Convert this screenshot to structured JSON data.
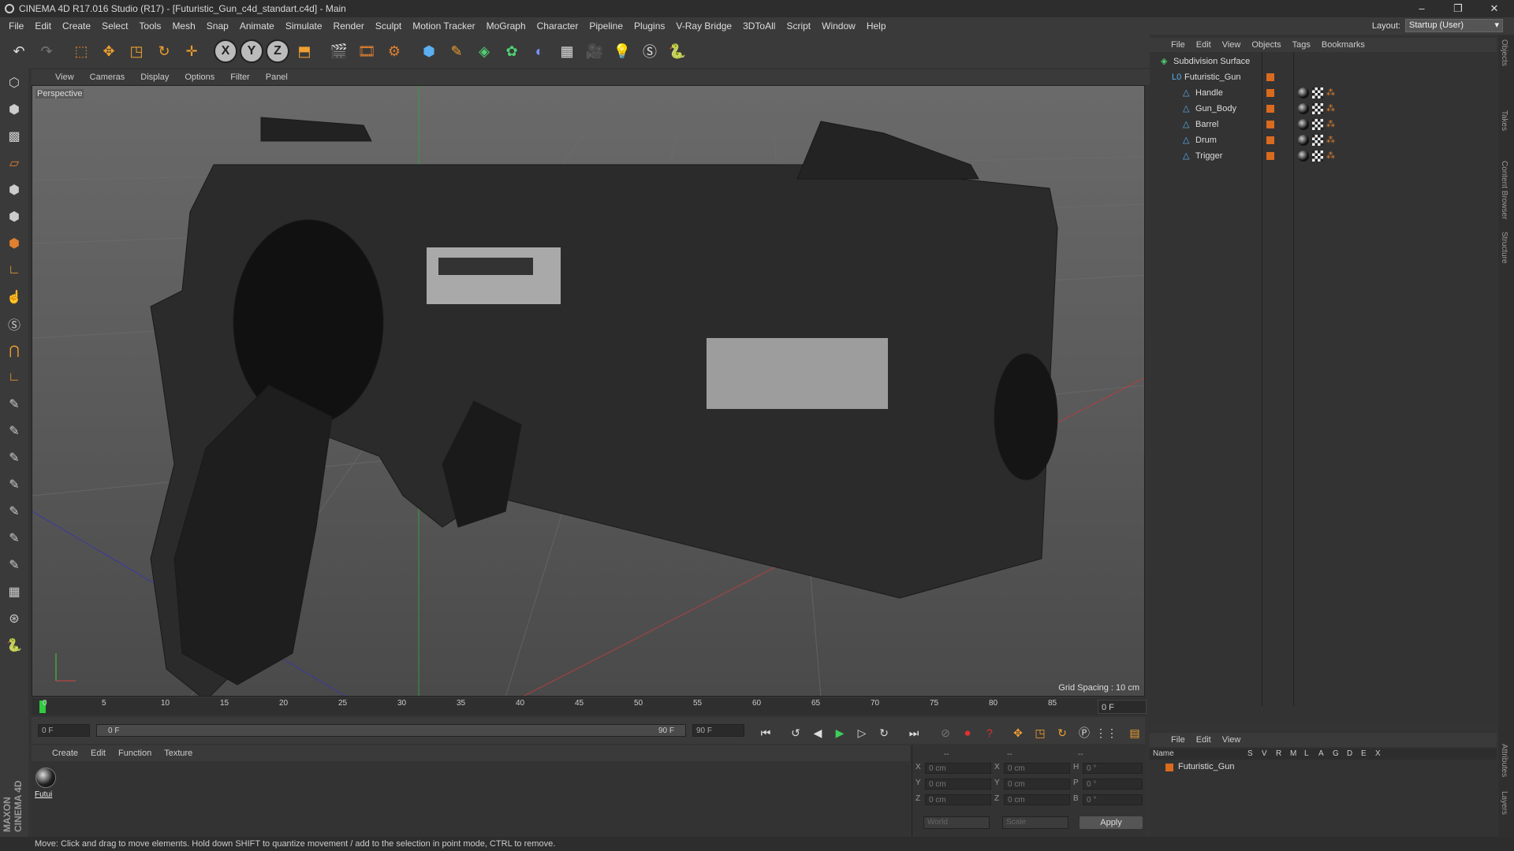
{
  "window": {
    "title": "CINEMA 4D R17.016 Studio (R17) - [Futuristic_Gun_c4d_standart.c4d] - Main",
    "minimize": "–",
    "restore": "❐",
    "close": "✕"
  },
  "menu": [
    "File",
    "Edit",
    "Create",
    "Select",
    "Tools",
    "Mesh",
    "Snap",
    "Animate",
    "Simulate",
    "Render",
    "Sculpt",
    "Motion Tracker",
    "MoGraph",
    "Character",
    "Pipeline",
    "Plugins",
    "V-Ray Bridge",
    "3DToAll",
    "Script",
    "Window",
    "Help"
  ],
  "layout": {
    "label": "Layout:",
    "value": "Startup (User)"
  },
  "toolbar": {
    "x": "X",
    "y": "Y",
    "z": "Z"
  },
  "viewport": {
    "menu": [
      "View",
      "Cameras",
      "Display",
      "Options",
      "Filter",
      "Panel"
    ],
    "label": "Perspective",
    "grid_spacing": "Grid Spacing : 10 cm"
  },
  "timeline": {
    "ticks": [
      "0",
      "5",
      "10",
      "15",
      "20",
      "25",
      "30",
      "35",
      "40",
      "45",
      "50",
      "55",
      "60",
      "65",
      "70",
      "75",
      "80",
      "85",
      "90"
    ],
    "current_frame": "0 F",
    "start_field": "0 F",
    "range_start": "0 F",
    "range_end": "90 F",
    "end_field": "90 F"
  },
  "materials": {
    "menu": [
      "Create",
      "Edit",
      "Function",
      "Texture"
    ],
    "items": [
      {
        "name": "Futui"
      }
    ]
  },
  "coordinates": {
    "head": [
      "--",
      "--",
      "--"
    ],
    "rows": [
      {
        "axis": "X",
        "pos": "0 cm",
        "axis2": "X",
        "size": "0 cm",
        "rot_label": "H",
        "rot": "0 °"
      },
      {
        "axis": "Y",
        "pos": "0 cm",
        "axis2": "Y",
        "size": "0 cm",
        "rot_label": "P",
        "rot": "0 °"
      },
      {
        "axis": "Z",
        "pos": "0 cm",
        "axis2": "Z",
        "size": "0 cm",
        "rot_label": "B",
        "rot": "0 °"
      }
    ],
    "world": "World",
    "scale": "Scale",
    "apply": "Apply"
  },
  "objects": {
    "menu": [
      "File",
      "Edit",
      "View",
      "Objects",
      "Tags",
      "Bookmarks"
    ],
    "tree": [
      {
        "name": "Subdivision Surface",
        "indent": 0
      },
      {
        "name": "Futuristic_Gun",
        "indent": 1
      },
      {
        "name": "Handle",
        "indent": 2
      },
      {
        "name": "Gun_Body",
        "indent": 2
      },
      {
        "name": "Barrel",
        "indent": 2
      },
      {
        "name": "Drum",
        "indent": 2
      },
      {
        "name": "Trigger",
        "indent": 2
      }
    ]
  },
  "attributes": {
    "menu": [
      "File",
      "Edit",
      "View"
    ],
    "columns": [
      "Name",
      "S",
      "V",
      "R",
      "M",
      "L",
      "A",
      "G",
      "D",
      "E",
      "X"
    ],
    "row_name": "Futuristic_Gun"
  },
  "right_tabs": [
    "Objects",
    "Takes",
    "Content Browser",
    "Structure",
    "Attributes",
    "Layers"
  ],
  "status": "Move: Click and drag to move elements. Hold down SHIFT to quantize movement / add to the selection in point mode, CTRL to remove.",
  "colors": {
    "accent": "#d96a1e",
    "bg": "#343434"
  }
}
